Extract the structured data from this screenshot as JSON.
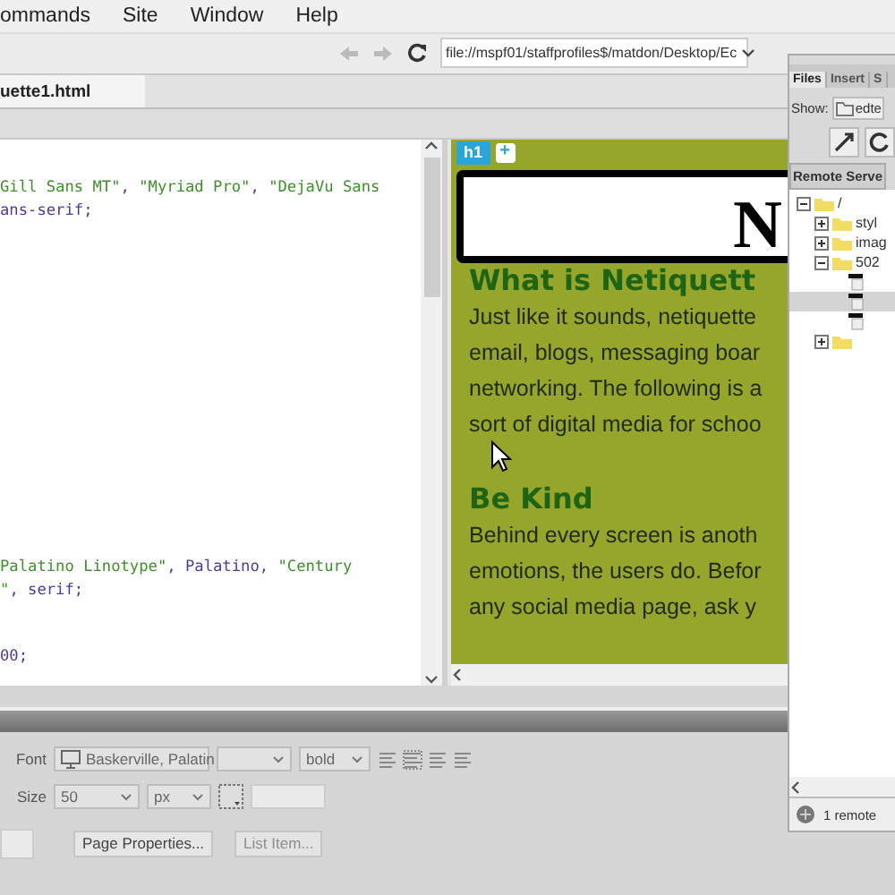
{
  "menu_bar": {
    "items": [
      "ommands",
      "Site",
      "Window",
      "Help"
    ]
  },
  "address_bar": {
    "value": "file://mspf01/staffprofiles$/matdon/Desktop/Ec"
  },
  "document_tabs": [
    {
      "label": "uette1.html",
      "selected": true
    }
  ],
  "code_view": {
    "blocks": [
      {
        "lines": [
          [
            {
              "kind": "string",
              "text": "Gill Sans MT\""
            },
            {
              "kind": "plain",
              "text": ", "
            },
            {
              "kind": "string",
              "text": "\"Myriad Pro\""
            },
            {
              "kind": "plain",
              "text": ", "
            },
            {
              "kind": "string",
              "text": "\"DejaVu Sans"
            }
          ],
          [
            {
              "kind": "plain",
              "text": "ans-serif;"
            }
          ]
        ]
      },
      {
        "lines": [
          [
            {
              "kind": "string",
              "text": "Palatino Linotype\""
            },
            {
              "kind": "plain",
              "text": ", Palatino, "
            },
            {
              "kind": "string",
              "text": "\"Century"
            }
          ],
          [
            {
              "kind": "string",
              "text": "\""
            },
            {
              "kind": "plain",
              "text": ", serif;"
            }
          ]
        ]
      },
      {
        "lines": [
          [
            {
              "kind": "plain",
              "text": "00;"
            }
          ]
        ]
      }
    ]
  },
  "live_view": {
    "tag_badge": "h1",
    "add_button": "+",
    "header_letter": "N",
    "sections": [
      {
        "heading": "What is Netiquett",
        "lines": [
          "Just like it sounds, netiquette",
          "email, blogs, messaging boar",
          "networking. The following is a",
          "sort of digital media for schoo"
        ]
      },
      {
        "heading": "Be Kind",
        "lines": [
          "Behind every screen is anoth",
          "emotions, the users do. Befor",
          "any social media page, ask y"
        ]
      }
    ]
  },
  "properties": {
    "font_label": "Font",
    "font_value": "Baskerville, Palatin",
    "weight_value": "bold",
    "size_label": "Size",
    "size_value": "50",
    "unit_value": "px",
    "buttons": [
      {
        "label": "Page Properties...",
        "disabled": false
      },
      {
        "label": "List Item...",
        "disabled": true
      }
    ]
  },
  "files_panel": {
    "tabs": [
      {
        "label": "Files",
        "selected": true
      },
      {
        "label": "Insert",
        "selected": false
      },
      {
        "label": "S",
        "selected": false
      }
    ],
    "show_label": "Show:",
    "site": "edte",
    "header": "Remote Serve",
    "status": "1 remote",
    "tree": [
      {
        "label": "/",
        "kind": "folder",
        "expanded": true,
        "selected": false,
        "children": [
          {
            "label": "styl",
            "kind": "folder",
            "expanded": false,
            "selected": false
          },
          {
            "label": "imag",
            "kind": "folder",
            "expanded": false,
            "selected": false
          },
          {
            "label": "502",
            "kind": "folder",
            "expanded": true,
            "selected": false,
            "children": [
              {
                "kind": "file",
                "selected": false
              },
              {
                "kind": "file",
                "selected": true
              },
              {
                "kind": "file",
                "selected": false
              }
            ]
          },
          {
            "kind": "folder",
            "expanded": false,
            "selected": false
          }
        ]
      }
    ]
  }
}
